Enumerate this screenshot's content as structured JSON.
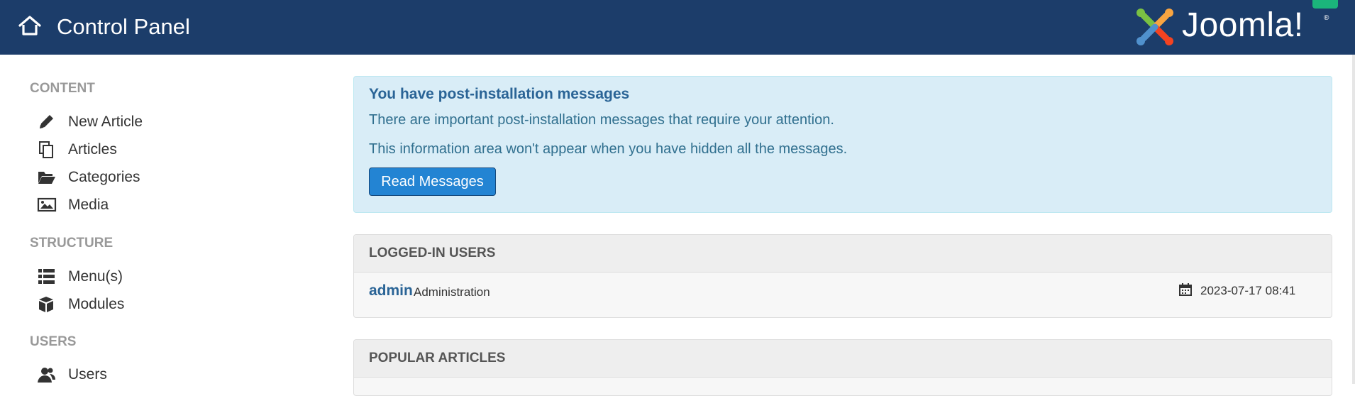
{
  "header": {
    "title": "Control Panel",
    "home_icon": "home-icon",
    "logo_text": "Joomla!",
    "logo_reg": "®",
    "bg_color": "#1c3d6a"
  },
  "sidebar": {
    "sections": [
      {
        "heading": "CONTENT",
        "items": [
          {
            "label": "New Article",
            "icon": "pencil-icon"
          },
          {
            "label": "Articles",
            "icon": "copy-icon"
          },
          {
            "label": "Categories",
            "icon": "folder-open-icon"
          },
          {
            "label": "Media",
            "icon": "image-icon"
          }
        ]
      },
      {
        "heading": "STRUCTURE",
        "items": [
          {
            "label": "Menu(s)",
            "icon": "list-icon"
          },
          {
            "label": "Modules",
            "icon": "cube-icon"
          }
        ]
      },
      {
        "heading": "USERS",
        "items": [
          {
            "label": "Users",
            "icon": "users-icon"
          }
        ]
      }
    ]
  },
  "alert": {
    "title": "You have post-installation messages",
    "line1": "There are important post-installation messages that require your attention.",
    "line2": "This information area won't appear when you have hidden all the messages.",
    "button_label": "Read Messages",
    "bg_color": "#d9edf7",
    "button_color": "#2384d3"
  },
  "logged_in_users": {
    "title": "LOGGED-IN USERS",
    "rows": [
      {
        "user": "admin",
        "role": "Administration",
        "date_icon": "calendar-icon",
        "date": "2023-07-17 08:41"
      }
    ]
  },
  "popular_articles": {
    "title": "POPULAR ARTICLES"
  }
}
